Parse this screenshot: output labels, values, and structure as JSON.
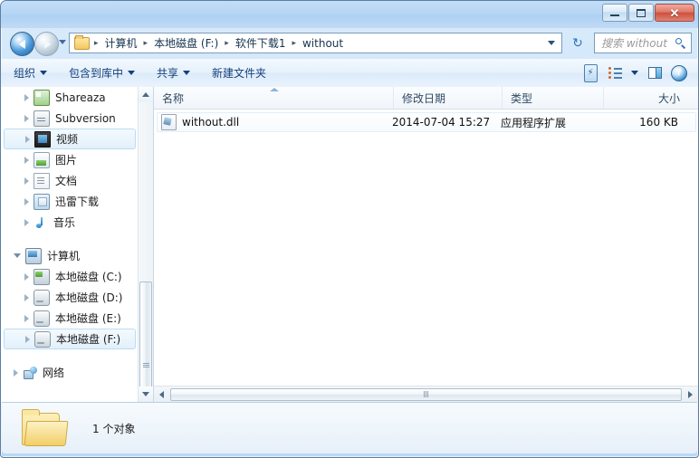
{
  "window": {
    "controls": {
      "minimize": "—",
      "maximize": "❐",
      "close": "✕"
    }
  },
  "navbar": {
    "back_tooltip": "后退",
    "forward_tooltip": "前进",
    "breadcrumbs": [
      "计算机",
      "本地磁盘 (F:)",
      "软件下载1",
      "without"
    ],
    "separator": "▸",
    "refresh_glyph": "↻",
    "search_placeholder": "搜索 without"
  },
  "toolbar": {
    "items": [
      {
        "label": "组织",
        "has_caret": true
      },
      {
        "label": "包含到库中",
        "has_caret": true
      },
      {
        "label": "共享",
        "has_caret": true
      },
      {
        "label": "新建文件夹",
        "has_caret": false
      }
    ],
    "right_icons": [
      "burn-icon",
      "view-mode-icon",
      "preview-pane-icon",
      "help-icon"
    ],
    "burn_glyph": "⚡",
    "help_glyph": "?"
  },
  "sidebar": {
    "items": [
      {
        "label": "Shareaza",
        "icon": "shareaza-icon",
        "indent": true,
        "selected": false,
        "twisty": "closed"
      },
      {
        "label": "Subversion",
        "icon": "subversion-icon",
        "indent": true,
        "selected": false,
        "twisty": "closed"
      },
      {
        "label": "视频",
        "icon": "video-icon",
        "indent": true,
        "selected": true,
        "twisty": "closed"
      },
      {
        "label": "图片",
        "icon": "pictures-icon",
        "indent": true,
        "selected": false,
        "twisty": "closed"
      },
      {
        "label": "文档",
        "icon": "documents-icon",
        "indent": true,
        "selected": false,
        "twisty": "closed"
      },
      {
        "label": "迅雷下载",
        "icon": "thunder-download-icon",
        "indent": true,
        "selected": false,
        "twisty": "closed"
      },
      {
        "label": "音乐",
        "icon": "music-icon",
        "indent": true,
        "selected": false,
        "twisty": "closed"
      },
      {
        "label": "计算机",
        "icon": "computer-icon",
        "indent": false,
        "selected": false,
        "twisty": "open",
        "gap_before": true
      },
      {
        "label": "本地磁盘 (C:)",
        "icon": "drive-c-icon",
        "indent": true,
        "selected": false,
        "twisty": "closed"
      },
      {
        "label": "本地磁盘 (D:)",
        "icon": "drive-icon",
        "indent": true,
        "selected": false,
        "twisty": "closed"
      },
      {
        "label": "本地磁盘 (E:)",
        "icon": "drive-icon",
        "indent": true,
        "selected": false,
        "twisty": "closed"
      },
      {
        "label": "本地磁盘 (F:)",
        "icon": "drive-icon",
        "indent": true,
        "selected": true,
        "twisty": "closed"
      },
      {
        "label": "网络",
        "icon": "network-icon",
        "indent": false,
        "selected": false,
        "twisty": "closed",
        "gap_before": true
      }
    ]
  },
  "filelist": {
    "columns": [
      {
        "key": "name",
        "label": "名称",
        "sorted": true
      },
      {
        "key": "date",
        "label": "修改日期",
        "sorted": false
      },
      {
        "key": "type",
        "label": "类型",
        "sorted": false
      },
      {
        "key": "size",
        "label": "大小",
        "sorted": false
      }
    ],
    "rows": [
      {
        "name": "without.dll",
        "date": "2014-07-04 15:27",
        "type": "应用程序扩展",
        "size": "160 KB",
        "icon": "dll-file-icon"
      }
    ]
  },
  "statusbar": {
    "text": "1 个对象",
    "icon": "open-folder-icon"
  }
}
